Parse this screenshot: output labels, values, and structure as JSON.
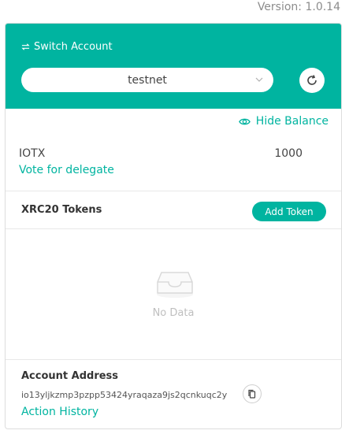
{
  "version": "Version: 1.0.14",
  "header": {
    "switch_label": "Switch Account",
    "switch_icon": "swap-icon",
    "network": "testnet",
    "refresh_icon": "refresh-icon"
  },
  "balance": {
    "toggle_label": "Hide Balance",
    "toggle_icon": "eye-icon",
    "token": "IOTX",
    "amount": "1000",
    "vote_label": "Vote for delegate"
  },
  "xrc20": {
    "title": "XRC20 Tokens",
    "add_label": "Add Token",
    "empty_text": "No Data"
  },
  "account": {
    "label": "Account Address",
    "address": "io13yljkzmp3pzpp53424yraqaza9js2qcnkuqc2y",
    "history_label": "Action History",
    "copy_icon": "copy-icon"
  },
  "colors": {
    "accent": "#00b4a0",
    "muted": "#8c8c8c"
  }
}
